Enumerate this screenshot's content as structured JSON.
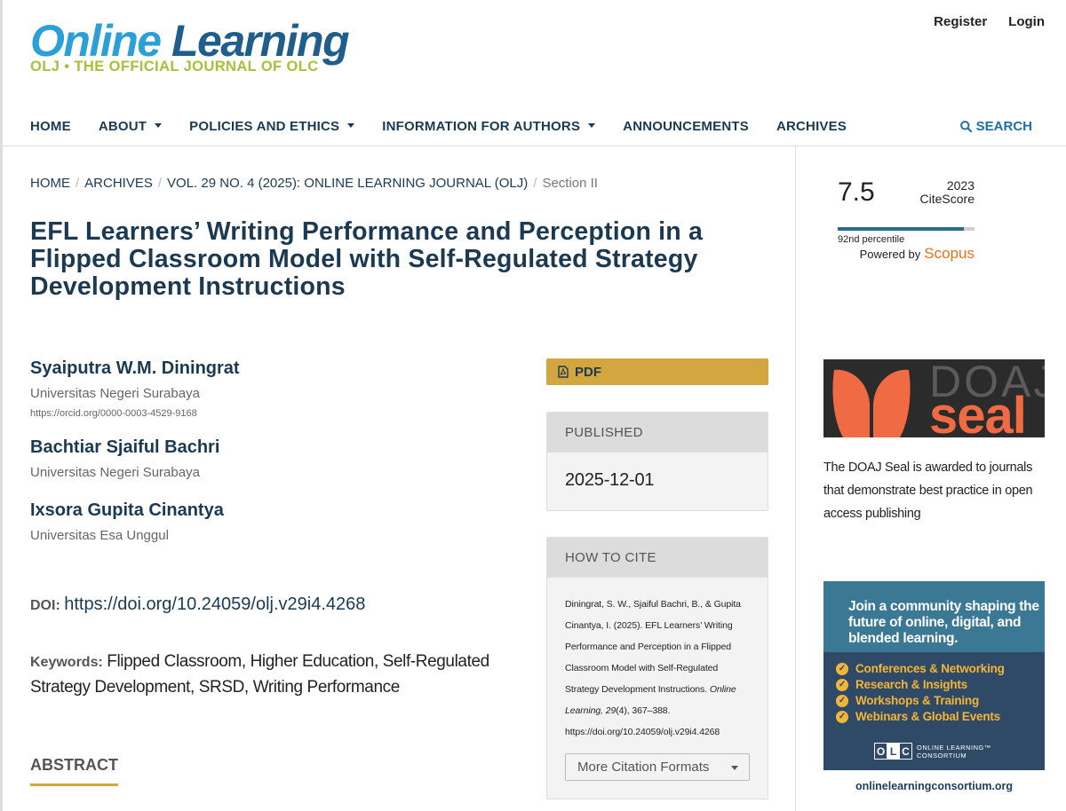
{
  "header": {
    "logo_main_1": "Online",
    "logo_main_2": "Learning",
    "logo_sub": "OLJ • THE OFFICIAL JOURNAL OF OLC",
    "register": "Register",
    "login": "Login"
  },
  "nav": {
    "home": "HOME",
    "about": "ABOUT",
    "policies": "POLICIES AND ETHICS",
    "info_authors": "INFORMATION FOR AUTHORS",
    "announcements": "ANNOUNCEMENTS",
    "archives": "ARCHIVES",
    "search": "SEARCH"
  },
  "breadcrumb": {
    "home": "HOME",
    "archives": "ARCHIVES",
    "issue": "VOL. 29 NO. 4 (2025): ONLINE LEARNING JOURNAL (OLJ)",
    "current": "Section II"
  },
  "article": {
    "title": "EFL Learners’ Writing Performance and Perception in a Flipped Classroom Model with Self-Regulated Strategy Development Instructions",
    "authors": [
      {
        "name": "Syaiputra W.M. Diningrat",
        "affiliation": "Universitas Negeri Surabaya",
        "orcid": "https://orcid.org/0000-0003-4529-9168"
      },
      {
        "name": "Bachtiar Sjaiful Bachri",
        "affiliation": "Universitas Negeri Surabaya"
      },
      {
        "name": "Ixsora Gupita Cinantya",
        "affiliation": "Universitas Esa Unggul"
      }
    ],
    "doi_label": "DOI:",
    "doi": "https://doi.org/10.24059/olj.v29i4.4268",
    "keywords_label": "Keywords:",
    "keywords": "Flipped Classroom, Higher Education, Self-Regulated Strategy Development, SRSD, Writing Performance",
    "abstract_heading": "ABSTRACT"
  },
  "sidebar_mid": {
    "pdf_label": "PDF",
    "published_head": "PUBLISHED",
    "published_date": "2025-12-01",
    "cite_head": "HOW TO CITE",
    "cite_pre": "Diningrat, S. W., Sjaiful Bachri, B., & Gupita Cinantya, I. (2025). EFL Learners’ Writing Performance and Perception in a Flipped Classroom Model with Self-Regulated Strategy Development Instructions. ",
    "cite_journal": "Online Learning,",
    "cite_vol": "29",
    "cite_post": "(4), 367–388. https://doi.org/10.24059/olj.v29i4.4268",
    "cite_formats": "More Citation Formats"
  },
  "sidebar_right": {
    "citescore_value": "7.5",
    "citescore_year": "2023",
    "citescore_label": "CiteScore",
    "percentile_text": "92nd percentile",
    "percentile_value": 0.92,
    "powered_by": "Powered by",
    "scopus": "Scopus",
    "doaj_text1": "DOAJ",
    "doaj_text2": "seal",
    "doaj_desc": "The DOAJ Seal is awarded to journals that demonstrate best practice in open access publishing",
    "olc_head": "Join a community shaping the future of online, digital, and blended learning.",
    "olc_items": [
      "Conferences & Networking",
      "Research & Insights",
      "Workshops & Training",
      "Webinars & Global Events"
    ],
    "olc_logo_name": "ONLINE LEARNING™ CONSORTIUM",
    "olc_url": "onlinelearningconsortium.org"
  },
  "colors": {
    "accent_gold": "#d4a640",
    "nav_text": "#1b3a52",
    "logo_blue": "#2a9fd8",
    "logo_green": "#a7c139",
    "scopus_orange": "#e9711c"
  }
}
